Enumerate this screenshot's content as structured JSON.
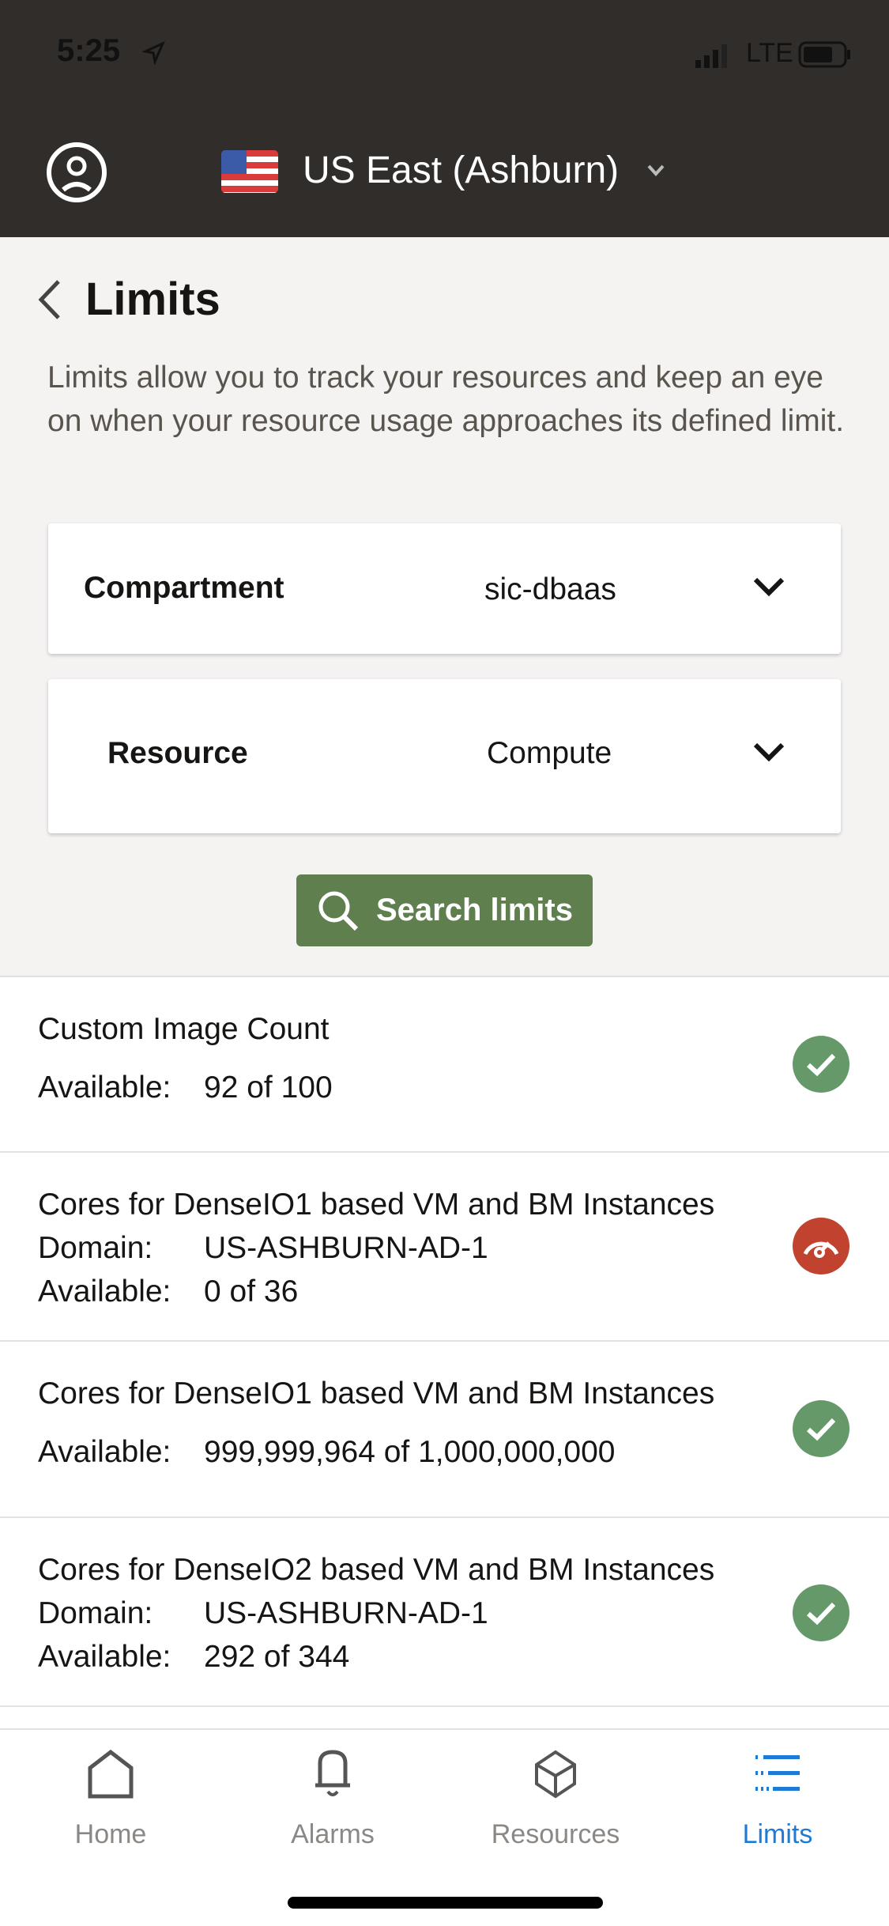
{
  "status_bar": {
    "time": "5:25",
    "network": "LTE"
  },
  "header": {
    "region": "US East (Ashburn)"
  },
  "page": {
    "title": "Limits",
    "description": "Limits allow you to track your resources and keep an eye on when your resource usage approaches its defined limit."
  },
  "filters": {
    "compartment_label": "Compartment",
    "compartment_value": "sic-dbaas",
    "resource_label": "Resource",
    "resource_value": "Compute"
  },
  "search_button": "Search limits",
  "labels": {
    "domain": "Domain:",
    "available": "Available:"
  },
  "limits": [
    {
      "name": "Custom Image Count",
      "available": "92 of 100",
      "status": "ok"
    },
    {
      "name": "Cores for DenseIO1 based VM and BM Instances",
      "domain": "US-ASHBURN-AD-1",
      "available": "0 of 36",
      "status": "exhausted"
    },
    {
      "name": "Cores for DenseIO1 based VM and BM Instances",
      "available": "999,999,964 of 1,000,000,000",
      "status": "ok"
    },
    {
      "name": "Cores for DenseIO2 based VM and BM Instances",
      "domain": "US-ASHBURN-AD-1",
      "available": "292 of 344",
      "status": "ok"
    }
  ],
  "tabs": [
    {
      "label": "Home"
    },
    {
      "label": "Alarms"
    },
    {
      "label": "Resources"
    },
    {
      "label": "Limits",
      "active": true
    }
  ],
  "colors": {
    "ok": "#65996a",
    "exhausted": "#c0422f",
    "accent": "#1b7bd6",
    "button": "#5f7f4f",
    "header": "#312d2a"
  }
}
